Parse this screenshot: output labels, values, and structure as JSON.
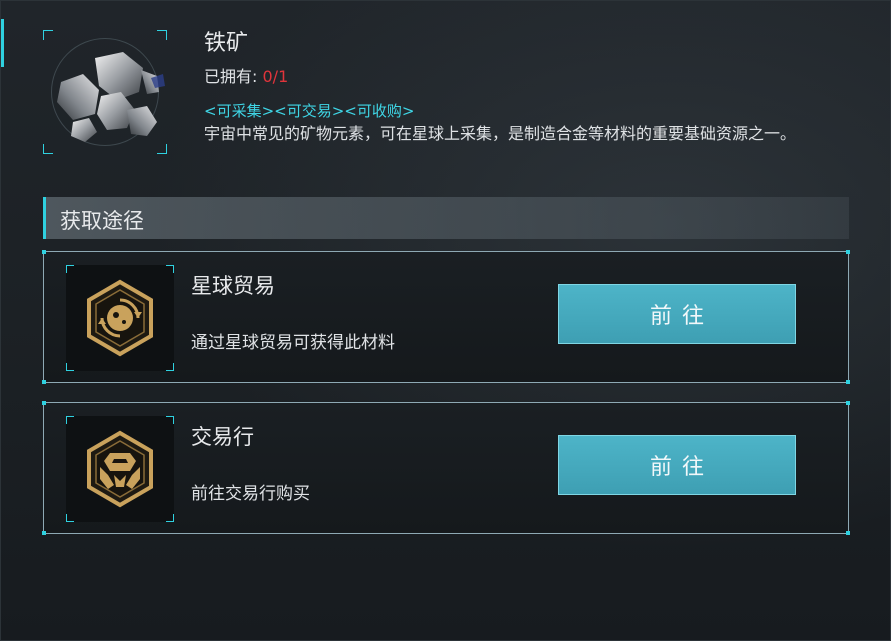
{
  "item": {
    "name": "铁矿",
    "owned_label": "已拥有:",
    "owned_count": "0/1",
    "tags": "<可采集><可交易><可收购>",
    "description": "宇宙中常见的矿物元素，可在星球上采集，是制造合金等材料的重要基础资源之一。",
    "icon": "iron-ore-icon"
  },
  "section": {
    "title": "获取途径"
  },
  "sources": [
    {
      "title": "星球贸易",
      "description": "通过星球贸易可获得此材料",
      "button": "前往",
      "icon": "planet-trade-icon"
    },
    {
      "title": "交易行",
      "description": "前往交易行购买",
      "button": "前往",
      "icon": "exchange-icon"
    }
  ],
  "colors": {
    "accent": "#2fd1e0",
    "button": "#45a9bd",
    "warning": "#e0343b",
    "gold": "#c9a25c"
  }
}
